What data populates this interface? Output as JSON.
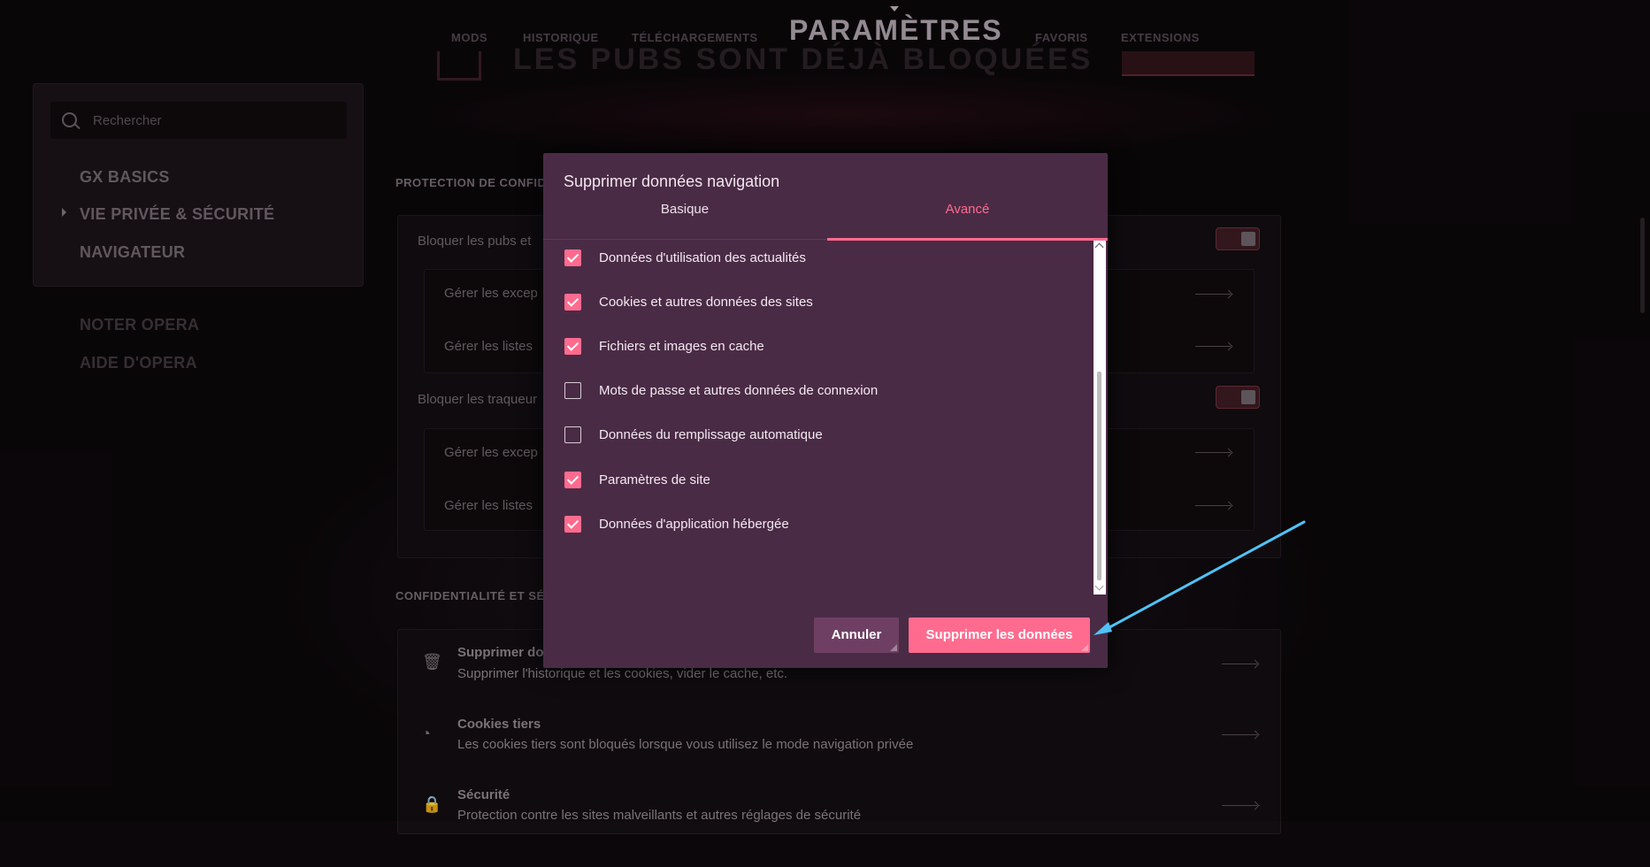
{
  "topnav": {
    "links_left": [
      "MODS",
      "HISTORIQUE",
      "TÉLÉCHARGEMENTS"
    ],
    "title": "PARAMÈTRES",
    "links_right": [
      "FAVORIS",
      "EXTENSIONS"
    ]
  },
  "banner": {
    "text": "LES PUBS SONT DÉJÀ BLOQUÉES"
  },
  "sidebar": {
    "search_placeholder": "Rechercher",
    "items": [
      "GX BASICS",
      "VIE PRIVÉE & SÉCURITÉ",
      "NAVIGATEUR"
    ],
    "links": [
      "NOTER OPERA",
      "AIDE D'OPERA"
    ]
  },
  "main": {
    "section1_title": "PROTECTION DE CONFIDE",
    "row_block_ads": "Bloquer les pubs et",
    "row_manage_exceptions": "Gérer les excep",
    "row_manage_lists": "Gérer les listes",
    "row_block_trackers": "Bloquer les traqueur",
    "section2_title": "CONFIDENTIALITÉ ET SÉC",
    "items": [
      {
        "title": "Supprimer do",
        "desc": "Supprimer l'historique et les cookies, vider le cache, etc."
      },
      {
        "title": "Cookies tiers",
        "desc": "Les cookies tiers sont bloqués lorsque vous utilisez le mode navigation privée"
      },
      {
        "title": "Sécurité",
        "desc": "Protection contre les sites malveillants et autres réglages de sécurité"
      }
    ]
  },
  "dialog": {
    "title": "Supprimer données navigation",
    "tabs": [
      "Basique",
      "Avancé"
    ],
    "active_tab": "Avancé",
    "options": [
      {
        "label": "Données d'utilisation des actualités",
        "checked": true
      },
      {
        "label": "Cookies et autres données des sites",
        "checked": true
      },
      {
        "label": "Fichiers et images en cache",
        "checked": true
      },
      {
        "label": "Mots de passe et autres données de connexion",
        "checked": false
      },
      {
        "label": "Données du remplissage automatique",
        "checked": false
      },
      {
        "label": "Paramètres de site",
        "checked": true
      },
      {
        "label": "Données d'application hébergée",
        "checked": true
      }
    ],
    "cancel_label": "Annuler",
    "confirm_label": "Supprimer les données"
  },
  "colors": {
    "accent": "#ff6b8f",
    "dialog_bg": "#4a2b45",
    "page_bg": "#0b070a",
    "annotation_arrow": "#4fc3f7"
  }
}
